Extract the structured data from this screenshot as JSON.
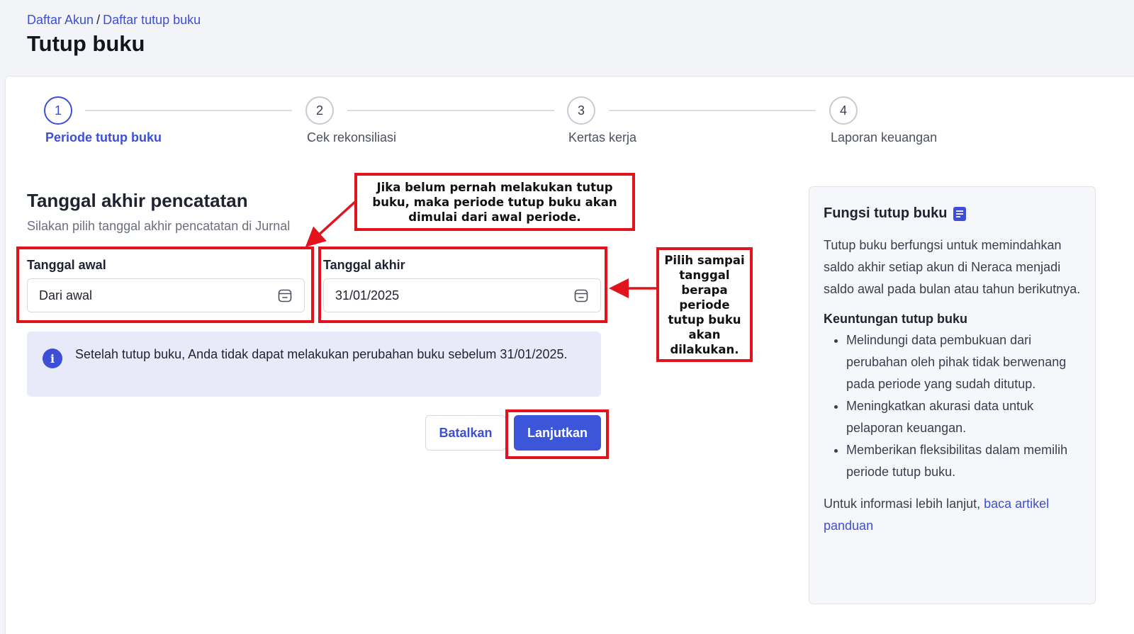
{
  "breadcrumb": {
    "item1": "Daftar Akun",
    "separator": "/",
    "item2": "Daftar tutup buku"
  },
  "page": {
    "title": "Tutup buku"
  },
  "stepper": {
    "steps": [
      {
        "number": "1",
        "label": "Periode tutup buku",
        "active": true
      },
      {
        "number": "2",
        "label": "Cek rekonsiliasi",
        "active": false
      },
      {
        "number": "3",
        "label": "Kertas kerja",
        "active": false
      },
      {
        "number": "4",
        "label": "Laporan keuangan",
        "active": false
      }
    ]
  },
  "form": {
    "title": "Tanggal akhir pencatatan",
    "subtitle": "Silakan pilih tanggal akhir pencatatan di Jurnal",
    "start": {
      "label": "Tanggal awal",
      "value": "Dari awal",
      "icon": "calendar-icon"
    },
    "end": {
      "label": "Tanggal akhir",
      "value": "31/01/2025",
      "icon": "calendar-icon"
    },
    "info": {
      "icon": "info-icon",
      "text": "Setelah tutup buku, Anda tidak dapat melakukan perubahan buku sebelum 31/01/2025."
    },
    "cancel_label": "Batalkan",
    "next_label": "Lanjutkan"
  },
  "side": {
    "title": "Fungsi tutup buku",
    "icon": "book-icon",
    "description": "Tutup buku berfungsi untuk memindahkan saldo akhir setiap akun di Neraca menjadi saldo awal pada bulan atau tahun berikutnya.",
    "benefits_title": "Keuntungan tutup buku",
    "benefits": [
      "Melindungi data pembukuan dari perubahan oleh pihak tidak berwenang pada periode yang sudah ditutup.",
      "Meningkatkan akurasi data untuk pelaporan keuangan.",
      "Memberikan fleksibilitas dalam memilih periode tutup buku."
    ],
    "footer_text": "Untuk informasi lebih lanjut,",
    "footer_link": "baca artikel panduan"
  },
  "annotations": {
    "note_start": "Jika belum pernah melakukan tutup buku, maka periode tutup buku akan dimulai dari awal periode.",
    "note_end": "Pilih sampai tanggal berapa periode tutup buku akan dilakukan.",
    "color": "#e1141d"
  },
  "colors": {
    "accent": "#3d4fd6",
    "button": "#3d55d8",
    "info_bg": "#e9eaf9"
  }
}
